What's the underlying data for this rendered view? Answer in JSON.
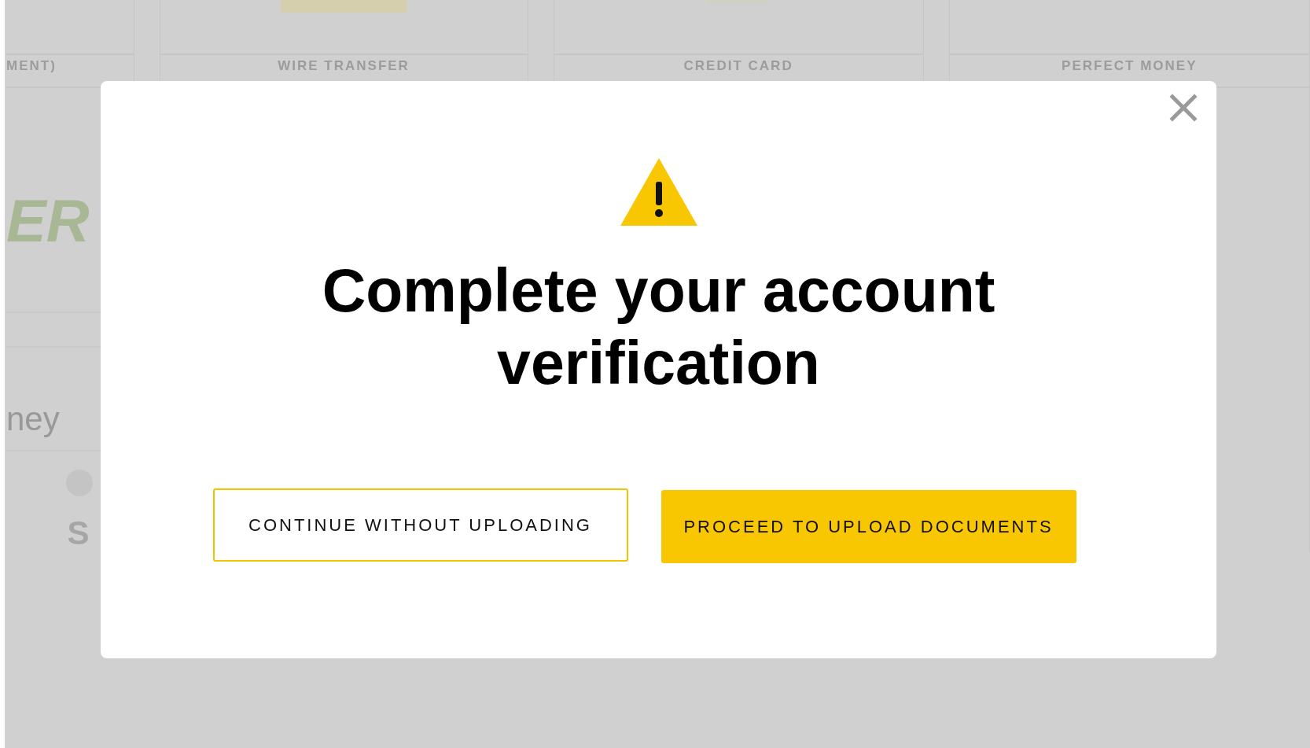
{
  "background": {
    "methods": [
      {
        "label": "MENT)"
      },
      {
        "label": "WIRE TRANSFER"
      },
      {
        "label": "CREDIT CARD"
      },
      {
        "label": "PERFECT MONEY"
      }
    ],
    "logo_text": "ER",
    "section_title": "ney",
    "item_text": "S"
  },
  "dialog": {
    "title": "Complete your account verification",
    "buttons": [
      {
        "label": "CONTINUE WITHOUT UPLOADING",
        "kind": "secondary"
      },
      {
        "label": "PROCEED TO UPLOAD DOCUMENTS",
        "kind": "primary"
      }
    ]
  }
}
